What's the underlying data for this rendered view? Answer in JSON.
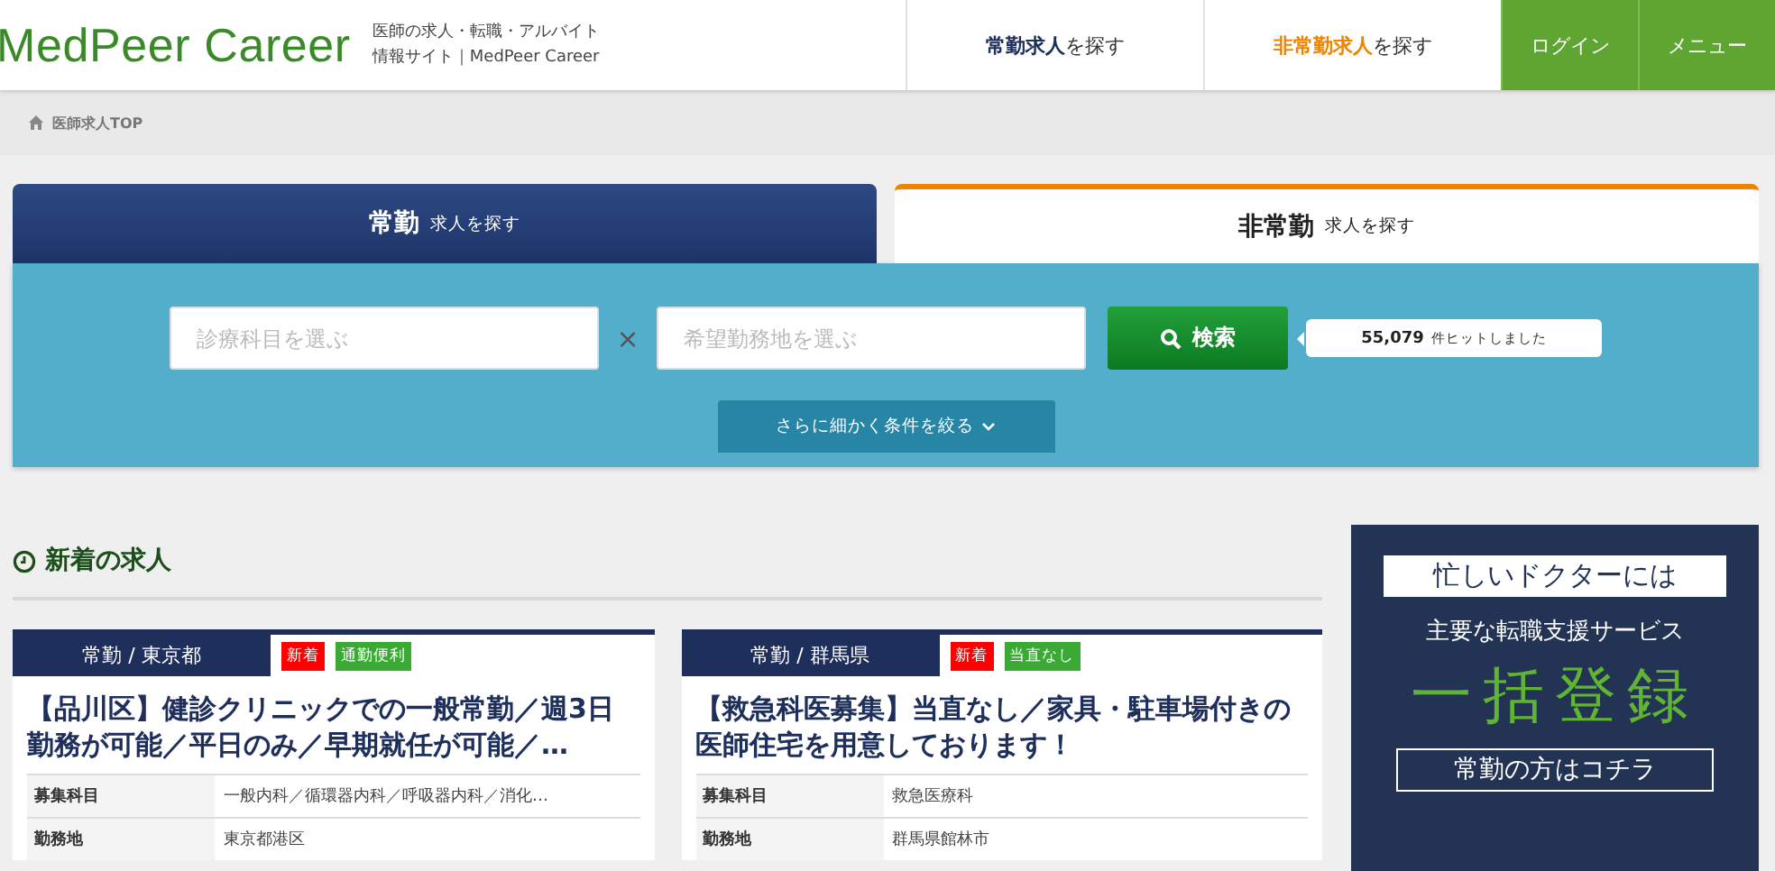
{
  "header": {
    "logo": "MedPeer Career",
    "tagline": [
      "医師の求人・転職・アルバイト",
      "情報サイト｜MedPeer Career"
    ],
    "nav": [
      {
        "kind": "link",
        "highlight": "常勤求人",
        "rest": "を探す",
        "color": "#1f2f5c"
      },
      {
        "kind": "link",
        "highlight": "非常勤求人",
        "rest": "を探す",
        "color": "#f08300"
      },
      {
        "kind": "button",
        "label": "ログイン"
      },
      {
        "kind": "button",
        "label": "メニュー"
      }
    ]
  },
  "breadcrumb": "医師求人TOP",
  "search": {
    "tabs": [
      {
        "main": "常勤",
        "sub": "求人を探す",
        "selected": true
      },
      {
        "main": "非常勤",
        "sub": "求人を探す",
        "selected": false
      }
    ],
    "specialty": {
      "placeholder": "診療科目を選ぶ"
    },
    "separator": "×",
    "location": {
      "placeholder": "希望勤務地を選ぶ"
    },
    "button": "検索",
    "hits": "55,079",
    "hits_suffix": "件ヒットしました",
    "more": "さらに細かく条件を絞る"
  },
  "new_jobs": {
    "title": "新着の求人",
    "cards": [
      {
        "label": "常勤 / 東京都",
        "tags": [
          {
            "text": "新着",
            "color": "#ff0000"
          },
          {
            "text": "通勤便利",
            "color": "#3aaa35"
          }
        ],
        "title": "【品川区】健診クリニックでの一般常勤／週3日勤務が可能／平日のみ／早期就任が可能／…",
        "rows": [
          {
            "label": "募集科目",
            "value": "一般内科／循環器内科／呼吸器内科／消化…"
          },
          {
            "label": "勤務地",
            "value": "東京都港区"
          }
        ]
      },
      {
        "label": "常勤 / 群馬県",
        "tags": [
          {
            "text": "新着",
            "color": "#ff0000"
          },
          {
            "text": "当直なし",
            "color": "#3aaa35"
          }
        ],
        "title": "【救急科医募集】当直なし／家具・駐車場付きの医師住宅を用意しております！",
        "rows": [
          {
            "label": "募集科目",
            "value": "救急医療科"
          },
          {
            "label": "勤務地",
            "value": "群馬県館林市"
          }
        ]
      }
    ]
  },
  "banner": {
    "top": "忙しいドクターには",
    "middle": "主要な転職支援サービス",
    "big": "一括登録",
    "bottom": "常勤の方はコチラ"
  }
}
